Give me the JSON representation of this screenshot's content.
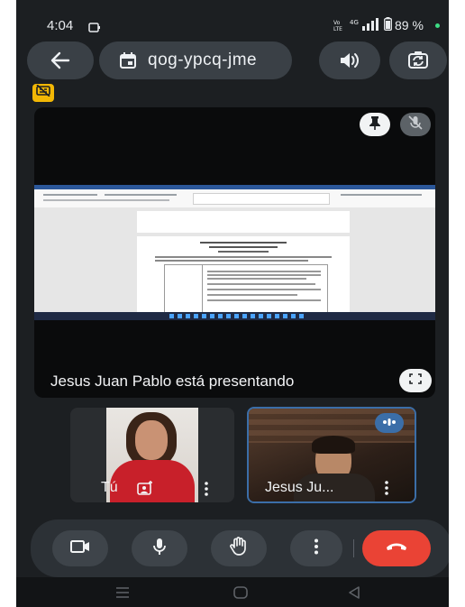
{
  "status_bar": {
    "time": "4:04",
    "notification_icon": "screen-cast-icon",
    "battery_percent": "89 %",
    "signal_text": "4G"
  },
  "top_bar": {
    "back_icon": "arrow-left-icon",
    "calendar_icon": "calendar-icon",
    "meeting_code": "qog-ypcq-jme",
    "speaker_icon": "speaker-icon",
    "switch_camera_icon": "switch-camera-icon"
  },
  "captions_badge_icon": "captions-off-icon",
  "presentation": {
    "presenter_text": "Jesus Juan Pablo está presentando",
    "pin_icon": "pin-icon",
    "mute_icon": "mic-off-icon",
    "fullscreen_icon": "fullscreen-icon"
  },
  "tiles": [
    {
      "name": "Tú",
      "effects_icon": "background-effects-icon",
      "more_icon": "more-vertical-icon"
    },
    {
      "name": "Jesus Ju...",
      "speaking_icon": "audio-level-icon",
      "more_icon": "more-vertical-icon"
    }
  ],
  "controls": {
    "camera": "video-camera-icon",
    "mic": "microphone-icon",
    "hand": "raise-hand-icon",
    "more": "more-vertical-icon",
    "end_call": "end-call-icon",
    "end_call_color": "#ea4335"
  },
  "colors": {
    "background": "#1c1f22",
    "pill": "#3a4046",
    "active_speaker_border": "#3b6ea8",
    "badge_yellow": "#f2b705"
  }
}
